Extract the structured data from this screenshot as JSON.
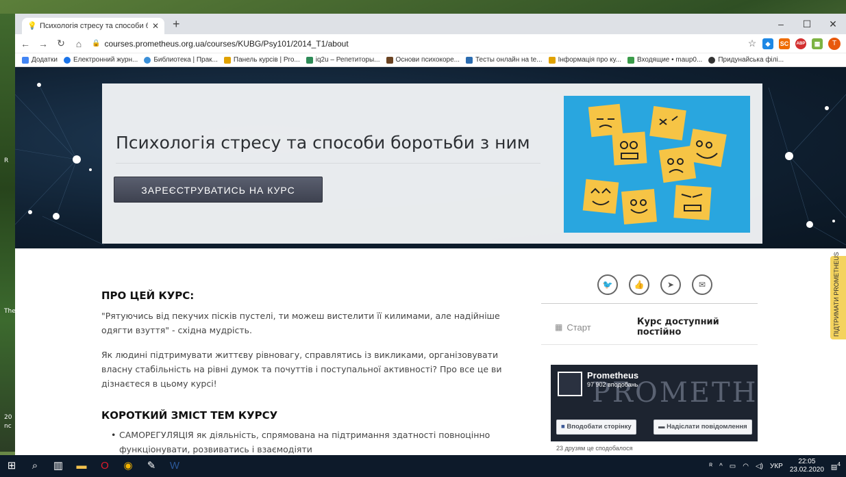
{
  "browser": {
    "tab_title": "Психологія стресу та способи б",
    "url": "courses.prometheus.org.ua/courses/KUBG/Psy101/2014_T1/about",
    "bookmarks": [
      {
        "label": "Додатки",
        "color": "#4285f4"
      },
      {
        "label": "Електронний журн...",
        "color": "#1a73e8"
      },
      {
        "label": "Библиотека | Прак...",
        "color": "#3a8fd8"
      },
      {
        "label": "Панель курсів | Pro...",
        "color": "#e0a200"
      },
      {
        "label": "iq2u – Репетиторы...",
        "color": "#2e8b57"
      },
      {
        "label": "Основи психокоре...",
        "color": "#6b4423"
      },
      {
        "label": "Тесты онлайн на te...",
        "color": "#2b6cb0"
      },
      {
        "label": "Інформація про ку...",
        "color": "#e0a200"
      },
      {
        "label": "Входящие • maup0...",
        "color": "#3b9c4a"
      },
      {
        "label": "Придунайська філі...",
        "color": "#333333"
      }
    ],
    "extensions": [
      {
        "label": "◆",
        "color": "#1e88e5"
      },
      {
        "label": "SC",
        "color": "#ef6c00"
      },
      {
        "label": "ABP",
        "color": "#d32f2f"
      },
      {
        "label": "▦",
        "color": "#7cb342"
      }
    ],
    "avatar_letter": "T"
  },
  "hero": {
    "course_title": "Психологія стресу та способи боротьби з ним",
    "enroll_label": "ЗАРЕЄСТРУВАТИСЬ НА КУРС"
  },
  "about": {
    "heading": "ПРО ЦЕЙ КУРС:",
    "paragraph1": "\"Рятуючись від пекучих пісків пустелі, ти можеш вистелити її килимами, але надійніше одягти взуття\" - східна мудрість.",
    "paragraph2": "Як людині підтримувати життєву рівновагу, справлятись із викликами, організовувати власну стабільність на рівні думок та почуттів і поступальної активності? Про все це ви дізнаєтеся в цьому курсі!",
    "summary_heading": "КОРОТКИЙ ЗМІСТ ТЕМ КУРСУ",
    "bullet1": "САМОРЕГУЛЯЦІЯ як діяльність, спрямована на підтримання здатності повноцінно функціонувати, розвиватись і взаємодіяти"
  },
  "sidebar": {
    "start_label": "Старт",
    "start_value": "Курс доступний постійно",
    "fb_name": "Prometheus",
    "fb_likes": "97 902 вподобань",
    "fb_bg_text": "PROMETHEUS",
    "fb_like_btn": "Вподобати сторінку",
    "fb_msg_btn": "Надіслати повідомлення",
    "fb_friends": "23 друзям це сподобалося"
  },
  "helper_tab": "ПІДТРИМАТИ PROMETHEUS",
  "taskbar": {
    "lang": "УКР",
    "time": "22:05",
    "date": "23.02.2020",
    "notif_count": "4"
  }
}
